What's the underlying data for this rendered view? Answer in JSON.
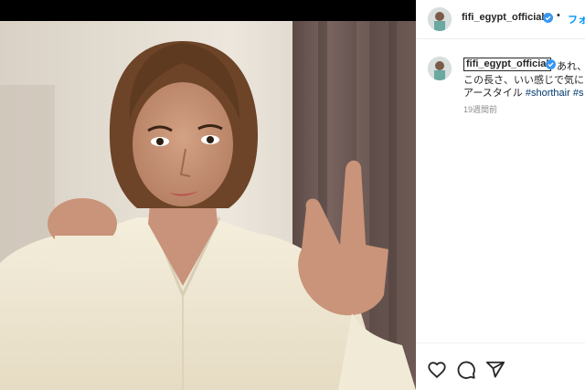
{
  "post": {
    "username": "fifi_egypt_official",
    "follow_label": "フォ",
    "separator": "•",
    "caption_line1": "あれ、",
    "caption_line2": "この長さ、いい感じで気に",
    "caption_line3_text": "アースタイル",
    "caption_hashtag1": "#shorthair",
    "caption_hashtag2": "#s",
    "timestamp": "19週間前"
  },
  "icons": {
    "verified": "verified-badge-icon",
    "like": "heart-icon",
    "comment": "comment-icon",
    "share": "share-icon"
  },
  "colors": {
    "accent": "#0095f6",
    "verified": "#3897f0",
    "text": "#262626",
    "muted": "#8e8e8e",
    "hashtag": "#00376b"
  }
}
